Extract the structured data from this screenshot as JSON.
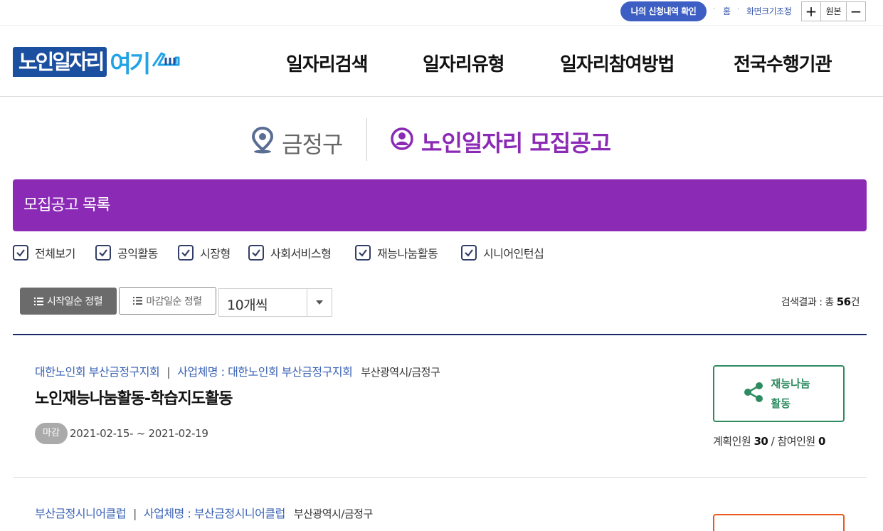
{
  "utility": {
    "apply_check": "나의 신청내역 확인",
    "home": "홈",
    "font_adjust": "화면크기조정",
    "zoom_in": "+",
    "zoom_reset": "원본",
    "zoom_out": "−"
  },
  "header": {
    "logo_main": "노인일자리",
    "logo_accent": "여기",
    "nav": [
      "일자리검색",
      "일자리유형",
      "일자리참여방법",
      "전국수행기관"
    ]
  },
  "region": {
    "location": "금정구",
    "title": "노인일자리 모집공고"
  },
  "list": {
    "heading": "모집공고 목록",
    "filters": [
      "전체보기",
      "공익활동",
      "시장형",
      "사회서비스형",
      "재능나눔활동",
      "시니어인턴십"
    ],
    "sort_start": "시작일순 정렬",
    "sort_end": "마감일순 정렬",
    "page_size": "10개씩",
    "result_prefix": "검색결과 : 총",
    "result_count": "56",
    "result_suffix": "건"
  },
  "jobs": [
    {
      "org": "대한노인회 부산금정구지회",
      "separator": "|",
      "business": "사업체명 : 대한노인회 부산금정구지회",
      "location": "부산광역시/금정구",
      "title": "노인재능나눔활동-학습지도활동",
      "status": "마감",
      "period": "2021-02-15- ~ 2021-02-19",
      "type": "재능나눔활동",
      "planned_label": "계획인원",
      "planned": "30",
      "slash": "/",
      "joined_label": "참여인원",
      "joined": "0"
    },
    {
      "org": "부산금정시니어클럽",
      "separator": "|",
      "business": "사업체명 : 부산금정시니어클럽",
      "location": "부산광역시/금정구"
    }
  ],
  "colors": {
    "brand_purple": "#8b2ab5",
    "brand_blue": "#1b4fa0",
    "talent_green": "#2e8b60",
    "market_orange": "#e85a1e"
  }
}
